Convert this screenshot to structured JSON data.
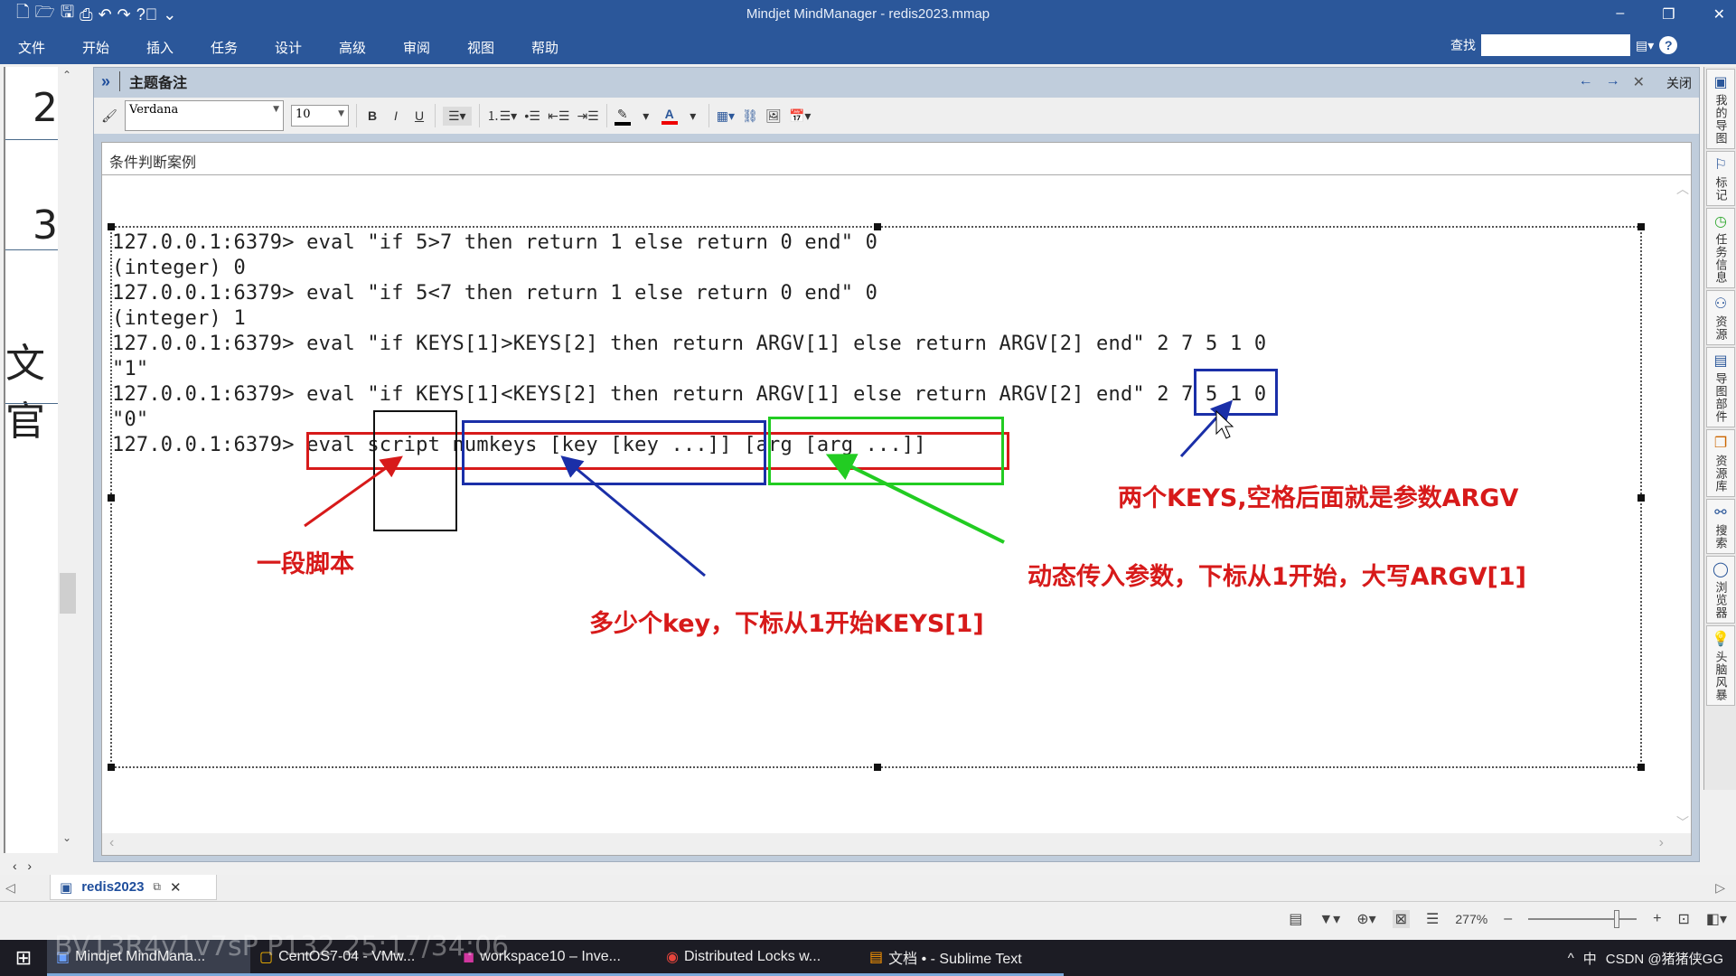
{
  "window": {
    "title": "Mindjet MindManager - redis2023.mmap",
    "controls": [
      "–",
      "❐",
      "✕"
    ]
  },
  "qat": {
    "icons": [
      "new-icon",
      "open-icon",
      "save-icon",
      "print-icon",
      "undo-icon",
      "redo-icon",
      "help-box-icon",
      "customize-icon"
    ]
  },
  "menu": [
    "文件",
    "开始",
    "插入",
    "任务",
    "设计",
    "高级",
    "审阅",
    "视图",
    "帮助"
  ],
  "search": {
    "label": "查找",
    "value": ""
  },
  "left_panel": {
    "numbers": [
      "2",
      "3"
    ],
    "partial_text": "文官"
  },
  "notes": {
    "expand": "»",
    "title": "主题备注",
    "close_label": "关闭",
    "toolbar": {
      "font": "Verdana",
      "size": "10",
      "bold": "B",
      "italic": "I",
      "underline": "U"
    },
    "subject": "条件判断案例"
  },
  "content": {
    "lines": [
      "127.0.0.1:6379> eval \"if 5>7 then return 1 else return 0 end\" 0",
      "(integer) 0",
      "127.0.0.1:6379> eval \"if 5<7 then return 1 else return 0 end\" 0",
      "(integer) 1",
      "127.0.0.1:6379> eval \"if KEYS[1]>KEYS[2] then return ARGV[1] else return ARGV[2] end\" 2 7 5 1 0",
      "\"1\"",
      "127.0.0.1:6379> eval \"if KEYS[1]<KEYS[2] then return ARGV[1] else return ARGV[2] end\" 2 7 5 1 0",
      "\"0\"",
      "127.0.0.1:6379> eval script numkeys [key [key ...]] [arg [arg ...]]"
    ],
    "annotations": {
      "script": "一段脚本",
      "keys": "多少个key，下标从1开始KEYS[1]",
      "args": "动态传入参数，下标从1开始，大写ARGV[1]",
      "numkeys": "两个KEYS,空格后面就是参数ARGV"
    },
    "colors": {
      "red": "#d71a1a",
      "blue": "#1a2fa8",
      "green": "#22cc22",
      "black": "#111111"
    }
  },
  "right_bar": [
    "我的导图",
    "标记",
    "任务信息",
    "资源",
    "导图部件",
    "资源库",
    "搜索",
    "浏览器",
    "头脑风暴"
  ],
  "doc_tab": {
    "name": "redis2023"
  },
  "status": {
    "zoom": "277%"
  },
  "taskbar": {
    "items": [
      "Mindjet MindMana...",
      "CentOS7-04 - VMw...",
      "workspace10 – Inve...",
      "Distributed Locks w...",
      "文档 • - Sublime Text"
    ],
    "tray": [
      "^",
      "中",
      "CSDN @猪猪侠GG"
    ]
  },
  "watermark": "BV13R4y1v7sP P132 25:17/34:06"
}
